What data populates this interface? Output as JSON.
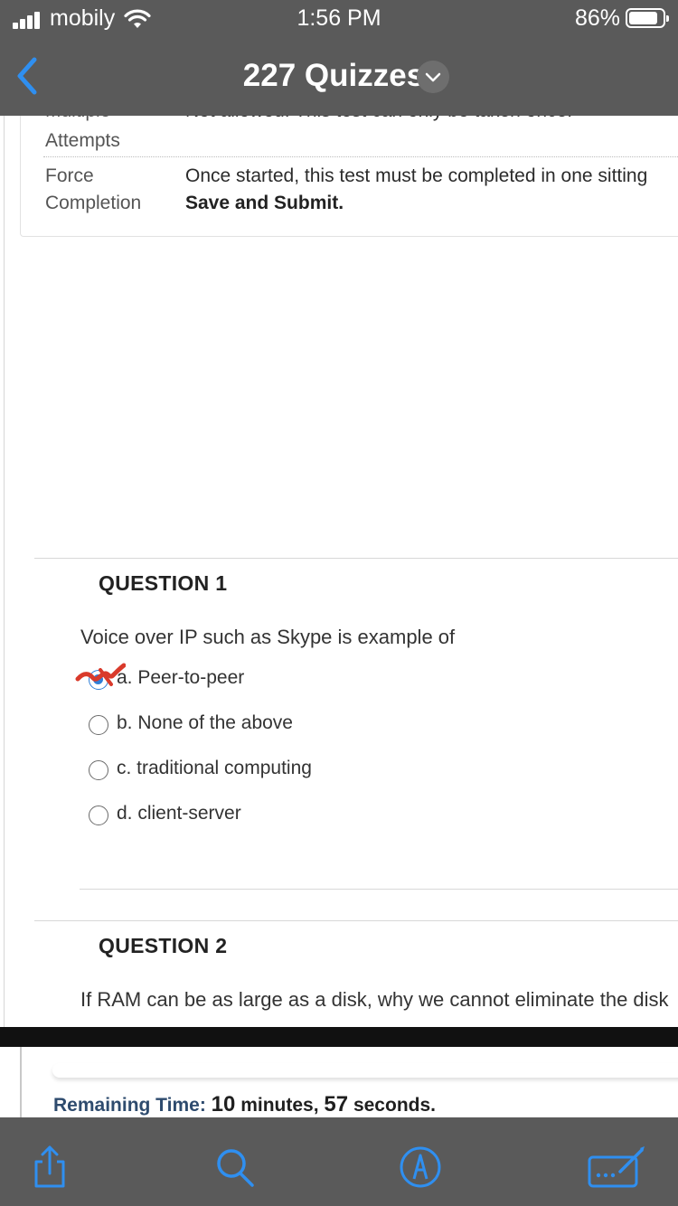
{
  "status_bar": {
    "carrier": "mobily",
    "time": "1:56 PM",
    "battery_percent": "86%",
    "battery_level": 0.86
  },
  "nav": {
    "title": "227 Quizzes",
    "back_icon": "chevron-left-icon",
    "dropdown_icon": "chevron-down-icon"
  },
  "test_info": {
    "rows": [
      {
        "label": "Multiple",
        "value": "Not allowed. This test can only be taken once."
      },
      {
        "label": "Attempts",
        "value": ""
      },
      {
        "label": "Force",
        "value": "Once started, this test must be completed in one sitting"
      },
      {
        "label": "Completion",
        "value": "Save and Submit."
      }
    ]
  },
  "questions": [
    {
      "title": "QUESTION 1",
      "text": "Voice over IP such as Skype is example of",
      "selected_index": 0,
      "options": [
        "a. Peer-to-peer",
        "b. None of the above",
        "c. traditional computing",
        "d. client-server"
      ]
    },
    {
      "title": "QUESTION 2",
      "text": "If RAM can be as large as a disk,  why we cannot eliminate the disk"
    }
  ],
  "timer": {
    "label": "Remaining Time:",
    "minutes": "10",
    "minutes_unit": "minutes,",
    "seconds": "57",
    "seconds_unit": "seconds."
  },
  "toolbar": {
    "icons": [
      "share-icon",
      "search-icon",
      "markup-icon",
      "keyboard-icon"
    ]
  },
  "colors": {
    "bar_background": "#5a5a5a",
    "accent_blue": "#2f7fd8",
    "scribble_red": "#d93a2b"
  }
}
